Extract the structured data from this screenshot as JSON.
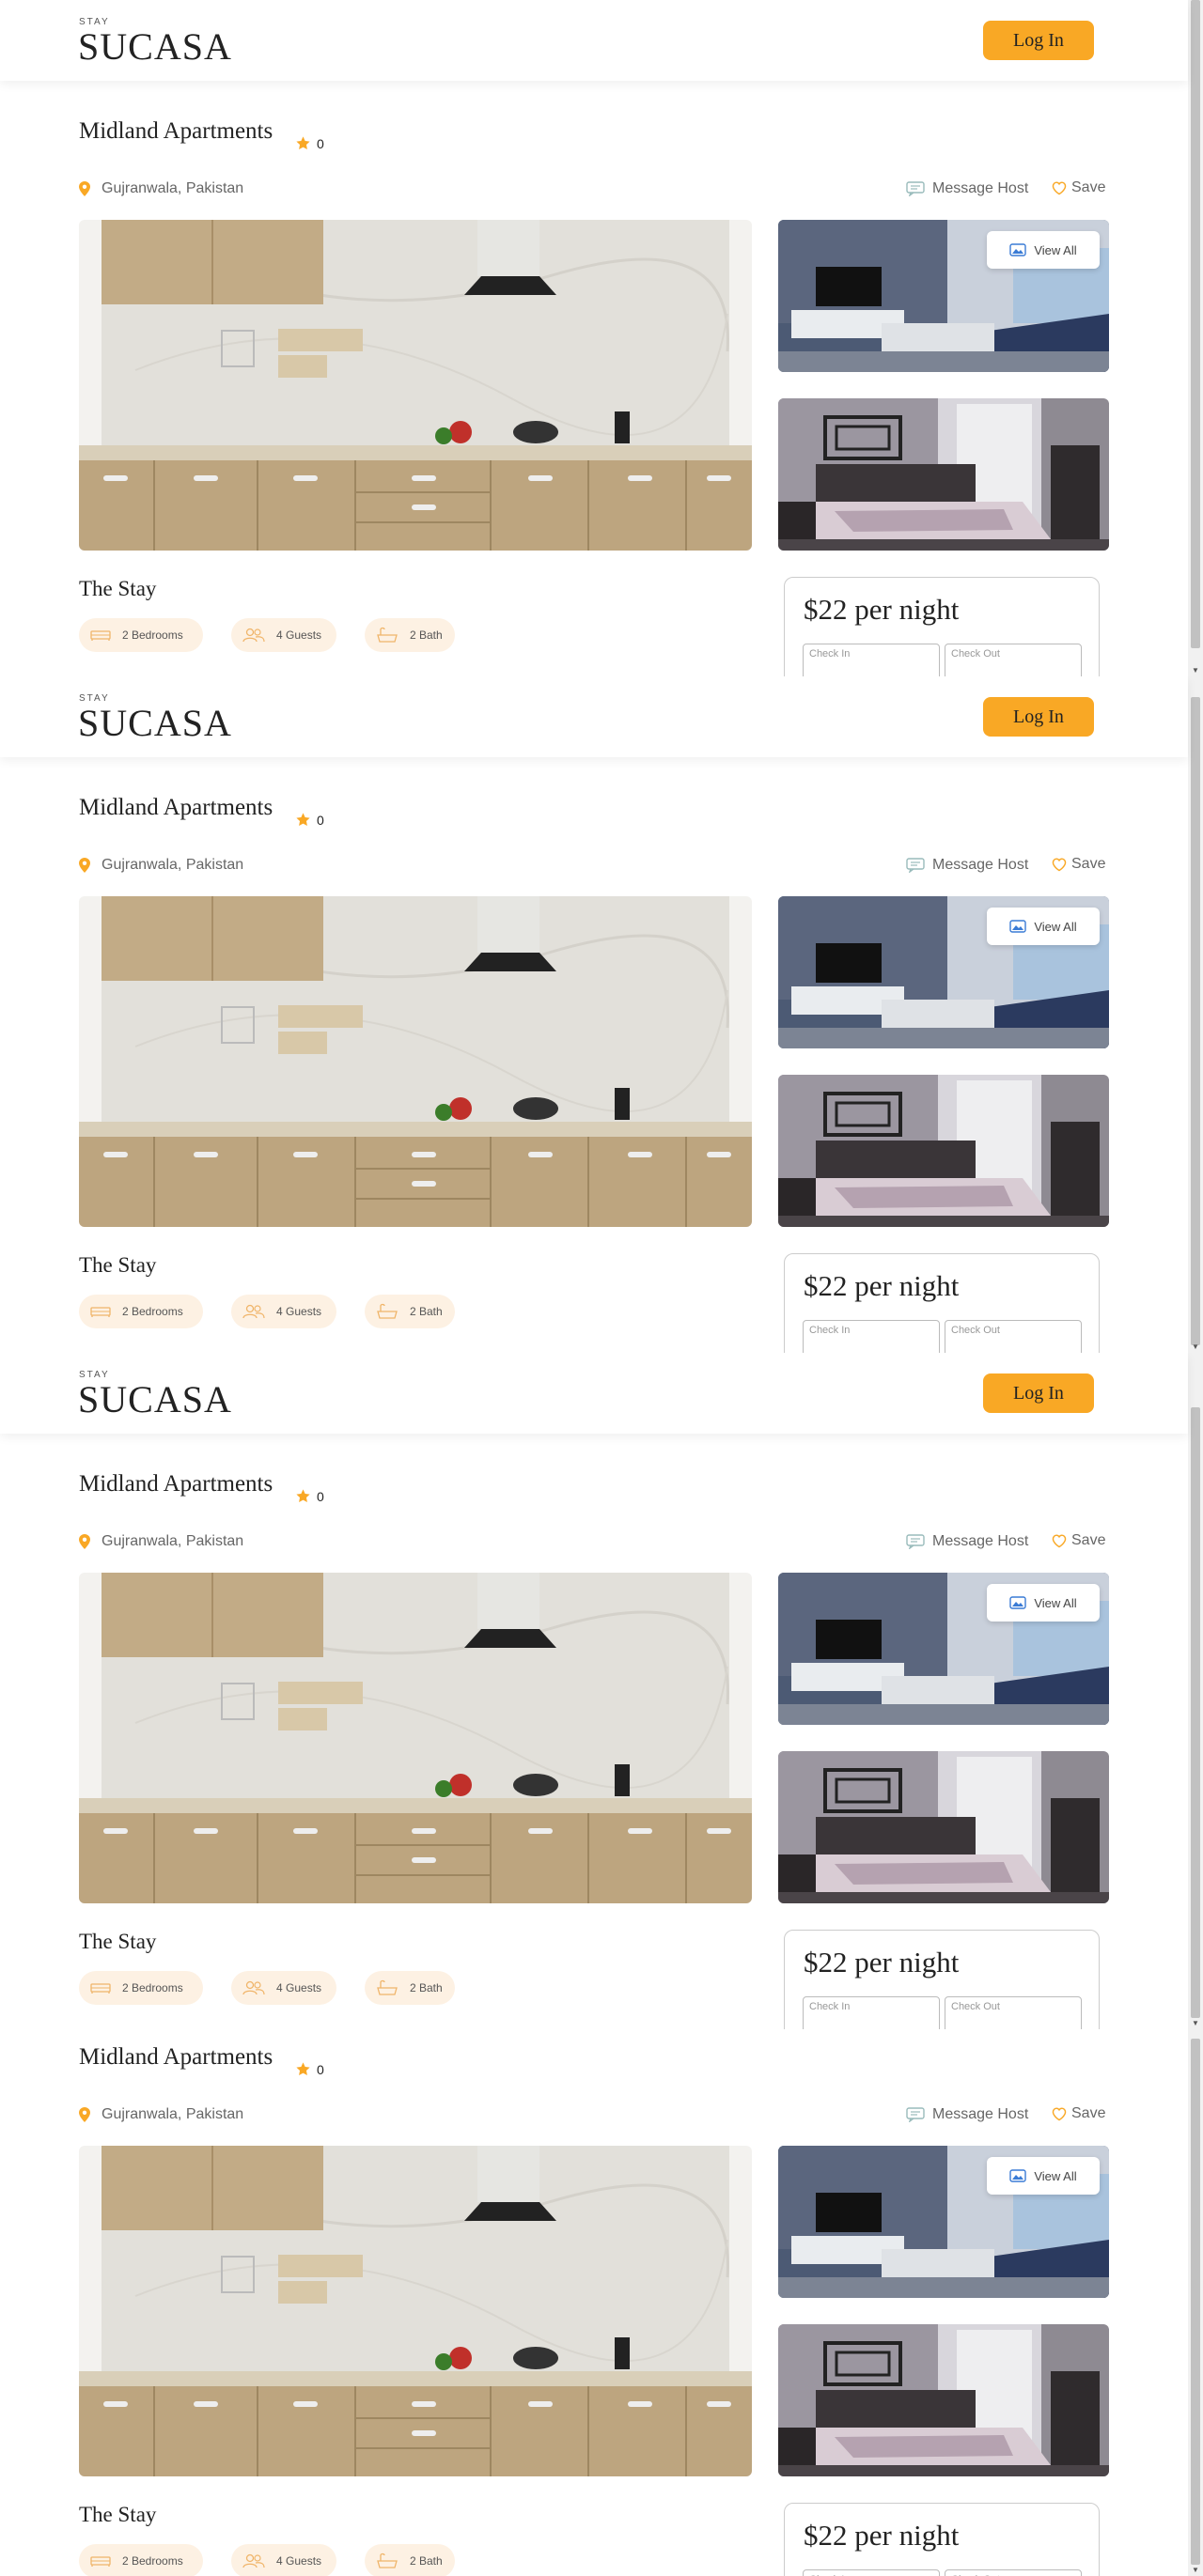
{
  "header": {
    "logo_small": "STAY",
    "logo_big": "SUCASA",
    "login_label": "Log In"
  },
  "listing": {
    "title": "Midland Apartments",
    "rating": "0",
    "location": "Gujranwala, Pakistan",
    "message_host": "Message Host",
    "save": "Save",
    "view_all": "View All",
    "stay_title": "The Stay",
    "amenities": [
      "2 Bedrooms",
      "4 Guests",
      "2 Bath"
    ],
    "price": "$22 per night",
    "check_in_placeholder": "Check In",
    "check_out_placeholder": "Check Out"
  },
  "colors": {
    "accent": "#f9a825",
    "amenity_bg": "#fdf1e3"
  },
  "icons": {
    "rating": "star-icon",
    "location": "location-pin-icon",
    "message": "chat-bubble-icon",
    "save": "heart-icon",
    "view_all": "image-gallery-icon",
    "amenities": [
      "bed-icon",
      "guests-icon",
      "bathtub-icon"
    ]
  }
}
